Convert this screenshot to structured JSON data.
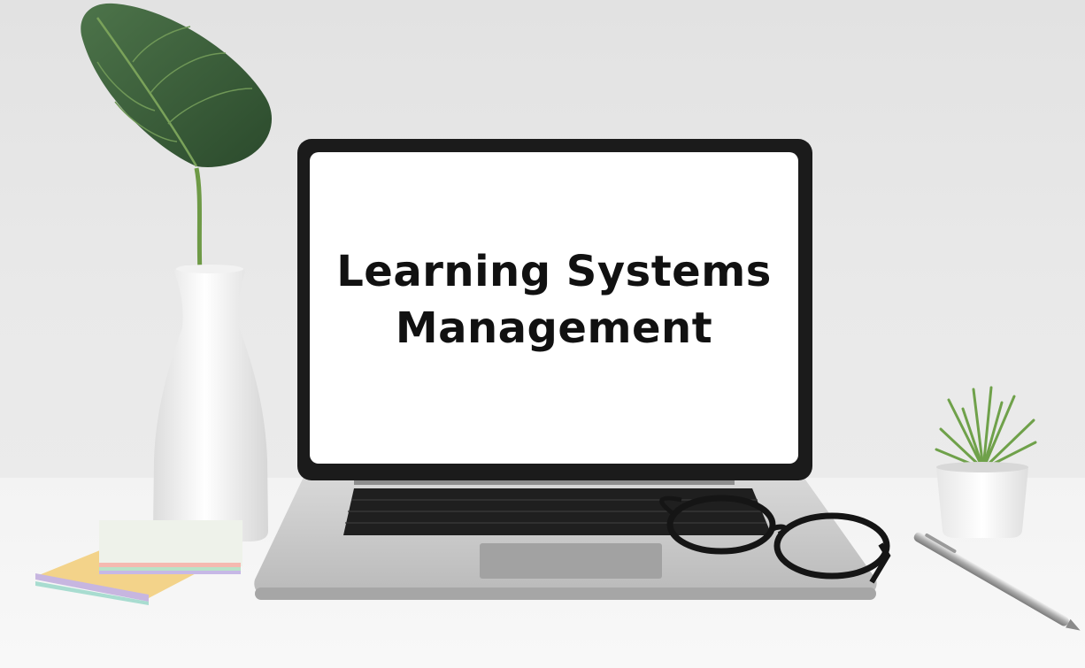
{
  "screen": {
    "title_line_1": "Learning Systems",
    "title_line_2": "Management"
  },
  "objects": {
    "laptop": "laptop",
    "vase": "white-vase",
    "leaf": "monstera-leaf",
    "succulent": "succulent-in-square-pot",
    "notes": "sticky-note-stack",
    "glasses": "eyeglasses",
    "pen": "silver-pen"
  },
  "colors": {
    "wall": "#e6e6e6",
    "desk": "#f5f5f5",
    "screen": "#ffffff",
    "bezel": "#1b1b1b",
    "laptop_body": "#c8c8c8",
    "leaf": "#3a5e3a"
  }
}
